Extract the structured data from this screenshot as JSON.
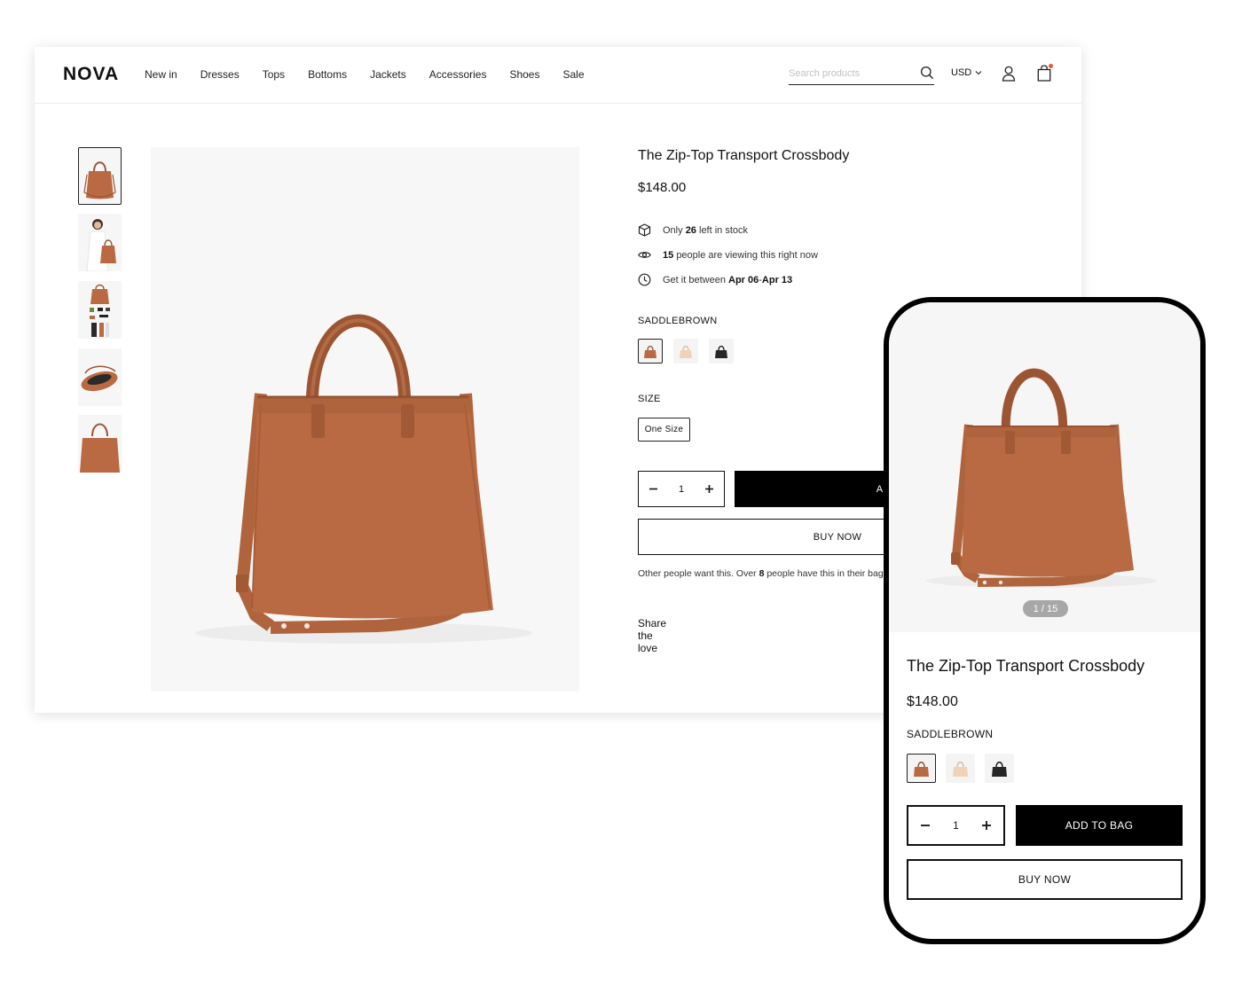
{
  "brand": "NOVA",
  "nav": [
    "New in",
    "Dresses",
    "Tops",
    "Bottoms",
    "Jackets",
    "Accessories",
    "Shoes",
    "Sale"
  ],
  "search": {
    "placeholder": "Search products"
  },
  "currency": "USD",
  "product": {
    "title": "The Zip-Top Transport Crossbody",
    "price": "$148.00",
    "stock": {
      "pre": "Only",
      "count": "26",
      "post": "left in stock"
    },
    "viewers": {
      "count": "15",
      "post": "people are viewing this right now"
    },
    "delivery": {
      "pre": "Get it between",
      "from": "Apr 06",
      "sep": " - ",
      "to": "Apr 13"
    },
    "color_label": "SADDLEBROWN",
    "size_label": "SIZE",
    "size_value": "One Size",
    "quantity": "1",
    "add_label": "ADD TO BAG",
    "buy_label": "BUY NOW",
    "others": {
      "pre": "Other people want this. Over",
      "count": "8",
      "post": "people have this in their bags right now."
    },
    "share_label": "Share the love"
  },
  "mobile": {
    "counter": "1 / 15",
    "title": "The Zip-Top Transport Crossbody",
    "price": "$148.00",
    "color_label": "SADDLEBROWN",
    "quantity": "1",
    "add_label": "ADD TO BAG",
    "buy_label": "BUY NOW"
  },
  "colors": {
    "leather": "#b96a42",
    "leather_dark": "#8f4b2b",
    "accent": "#e9553f",
    "black": "#000000"
  },
  "icons": [
    "search-icon",
    "chevron-down-icon",
    "user-icon",
    "shopping-bag-icon",
    "box-icon",
    "eye-icon",
    "clock-icon",
    "minus-icon",
    "plus-icon"
  ]
}
